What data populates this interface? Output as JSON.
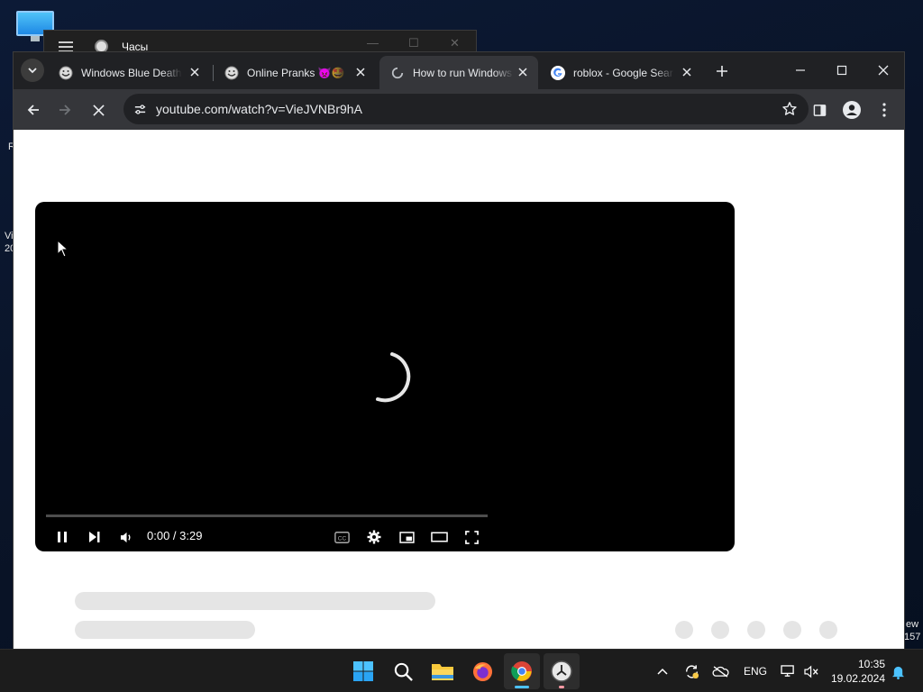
{
  "desktop": {
    "fragments": [
      "R",
      "Vi",
      "20",
      "ew",
      "157"
    ]
  },
  "clock_window": {
    "title": "Часы"
  },
  "browser": {
    "tabs": [
      {
        "title": "Windows Blue Death",
        "favicon": "troll-face-icon",
        "active": false
      },
      {
        "title": "Online Pranks 👿🤩",
        "favicon": "troll-face-icon",
        "active": false
      },
      {
        "title": "How to run Windows",
        "favicon": "loading-icon",
        "active": true
      },
      {
        "title": "roblox - Google Sear",
        "favicon": "google-g-icon",
        "active": false
      }
    ],
    "url": "youtube.com/watch?v=VieJVNBr9hA"
  },
  "player": {
    "time": "0:00 / 3:29",
    "progress": 0.0,
    "state": "loading"
  },
  "taskbar": {
    "apps": [
      "windows-start-icon",
      "search-icon",
      "file-explorer-icon",
      "firefox-icon",
      "chrome-icon",
      "clock-app-icon"
    ],
    "language": "ENG",
    "time": "10:35",
    "date": "19.02.2024"
  },
  "colors": {
    "chrome_dark": "#202124",
    "chrome_toolbar": "#35363a",
    "accent_blue": "#4cc2ff",
    "youtube_red": "#ff0000"
  }
}
